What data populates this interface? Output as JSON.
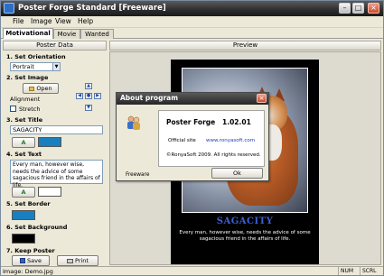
{
  "window": {
    "title": "Poster Forge Standard [Freeware]",
    "minimize": "–",
    "maximize": "□",
    "close": "×"
  },
  "menu": {
    "file": "File",
    "image": "Image",
    "view": "View",
    "help": "Help"
  },
  "tabs": [
    "Motivational",
    "Movie",
    "Wanted"
  ],
  "left_panel": {
    "header": "Poster Data",
    "orientation_label": "1. Set Orientation",
    "orientation_value": "Portrait",
    "image_label": "2. Set Image",
    "open_button": "Open",
    "alignment_label": "Alignment",
    "stretch_label": "Stretch",
    "title_label": "3. Set Title",
    "title_value": "SAGACITY",
    "text_label": "4. Set Text",
    "text_value": "Every man, however wise, needs the advice of some sagacious friend in the affairs of life.",
    "border_label": "5. Set Border",
    "background_label": "6. Set Background",
    "keep_label": "7. Keep Poster",
    "save_button": "Save",
    "print_button": "Print"
  },
  "right_panel": {
    "header": "Preview"
  },
  "poster": {
    "title": "SAGACITY",
    "text": "Every man, however wise, needs the advice of some sagacious friend in the affairs of life."
  },
  "about_dialog": {
    "title": "About program",
    "product": "Poster Forge",
    "version": "1.02.01",
    "site_label": "Official site",
    "site_url": "www.ronyasoft.com",
    "copyright": "©RonyaSoft 2009.  All rights reserved.",
    "license": "Freeware",
    "ok_button": "Ok",
    "close": "×"
  },
  "statusbar": {
    "image": "Image: Demo.jpg",
    "num": "NUM",
    "scrl": "SCRL"
  },
  "colors": {
    "title_color": "#3e5fd3",
    "text_color": "#ffffff",
    "border_color": "#1a7fbf",
    "background_color": "#000000"
  }
}
